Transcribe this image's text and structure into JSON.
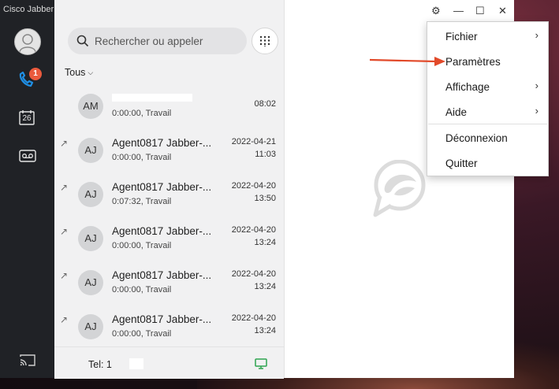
{
  "app": {
    "title": "Cisco Jabber"
  },
  "rail": {
    "call_badge": "1",
    "calendar_day": "26"
  },
  "search": {
    "placeholder": "Rechercher ou appeler"
  },
  "filter": {
    "label": "Tous"
  },
  "history": [
    {
      "initials": "AM",
      "name": "",
      "detail": "0:00:00, Travail",
      "date": "",
      "time": "08:02",
      "outgoing": false
    },
    {
      "initials": "AJ",
      "name": "Agent0817 Jabber-...",
      "detail": "0:00:00, Travail",
      "date": "2022-04-21",
      "time": "11:03",
      "outgoing": true
    },
    {
      "initials": "AJ",
      "name": "Agent0817 Jabber-...",
      "detail": "0:07:32, Travail",
      "date": "2022-04-20",
      "time": "13:50",
      "outgoing": true
    },
    {
      "initials": "AJ",
      "name": "Agent0817 Jabber-...",
      "detail": "0:00:00, Travail",
      "date": "2022-04-20",
      "time": "13:24",
      "outgoing": true
    },
    {
      "initials": "AJ",
      "name": "Agent0817 Jabber-...",
      "detail": "0:00:00, Travail",
      "date": "2022-04-20",
      "time": "13:24",
      "outgoing": true
    },
    {
      "initials": "AJ",
      "name": "Agent0817 Jabber-...",
      "detail": "0:00:00, Travail",
      "date": "2022-04-20",
      "time": "13:24",
      "outgoing": true
    }
  ],
  "footer": {
    "tel": "Tel: 1"
  },
  "window_controls": {
    "settings": "⚙",
    "minimize": "—",
    "maximize": "☐",
    "close": "✕"
  },
  "menu": {
    "items": [
      {
        "label": "Fichier",
        "submenu": "›"
      },
      {
        "label": "Paramètres",
        "submenu": ""
      },
      {
        "label": "Affichage",
        "submenu": "›"
      },
      {
        "label": "Aide",
        "submenu": "›"
      },
      {
        "label": "Déconnexion",
        "submenu": ""
      },
      {
        "label": "Quitter",
        "submenu": ""
      }
    ]
  },
  "colors": {
    "accent": "#0a7bd6",
    "badge": "#ea5a3d",
    "annotation_arrow": "#e24a2a",
    "rail": "#202226",
    "status_green": "#2ea44f"
  }
}
